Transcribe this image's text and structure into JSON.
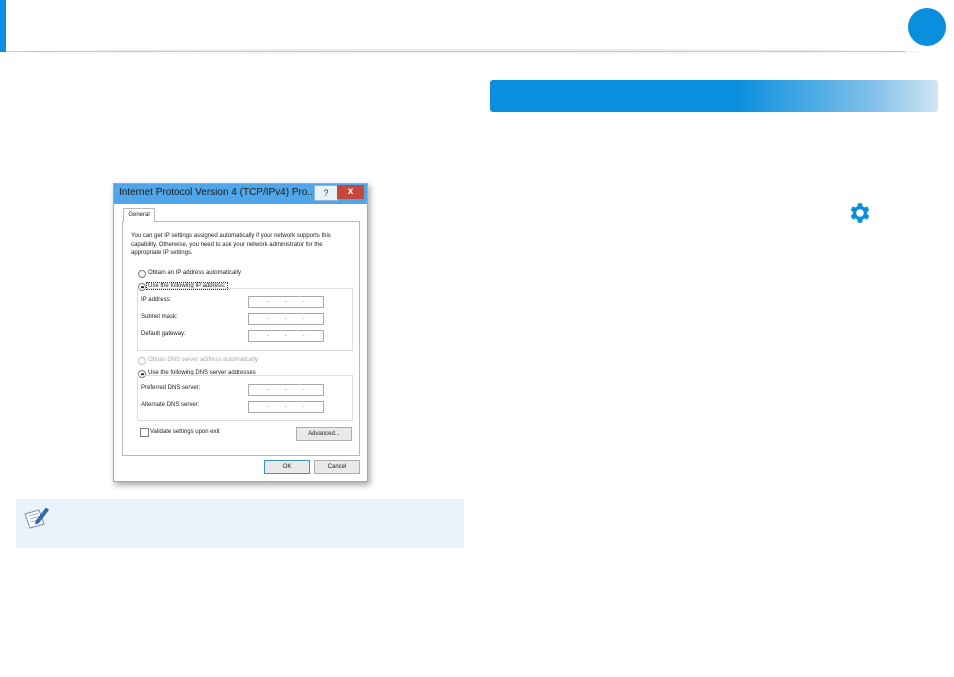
{
  "dialog": {
    "title": "Internet Protocol Version 4 (TCP/IPv4) Pro...",
    "help_label": "?",
    "close_label": "x",
    "tab_general": "General",
    "intro_text": "You can get IP settings assigned automatically if your network supports this capability. Otherwise, you need to ask your network administrator for the appropriate IP settings.",
    "obtain_ip_auto": "Obtain an IP address automatically",
    "use_following_ip": "Use the following IP address:",
    "ip_address_label": "IP address:",
    "subnet_mask_label": "Subnet mask:",
    "default_gateway_label": "Default gateway:",
    "obtain_dns_auto": "Obtain DNS server address automatically",
    "use_following_dns": "Use the following DNS server addresses",
    "preferred_dns_label": "Preferred DNS server:",
    "alternate_dns_label": "Alternate DNS server:",
    "validate_label": "Validate settings upon exit",
    "advanced_label": "Advanced...",
    "ok_label": "OK",
    "cancel_label": "Cancel",
    "ip_dot": ".",
    "selected_ip_option": "Use the following IP address:",
    "selected_dns_option": "Use the following DNS server addresses",
    "validate_checked": false
  },
  "colors": {
    "accent_blue": "#0a8fde",
    "title_bar": "#4fa6e8",
    "close_red": "#c7463b",
    "note_background": "#eaf2fb"
  },
  "icons": {
    "settings": "gear-icon",
    "note": "note-pencil-icon"
  }
}
